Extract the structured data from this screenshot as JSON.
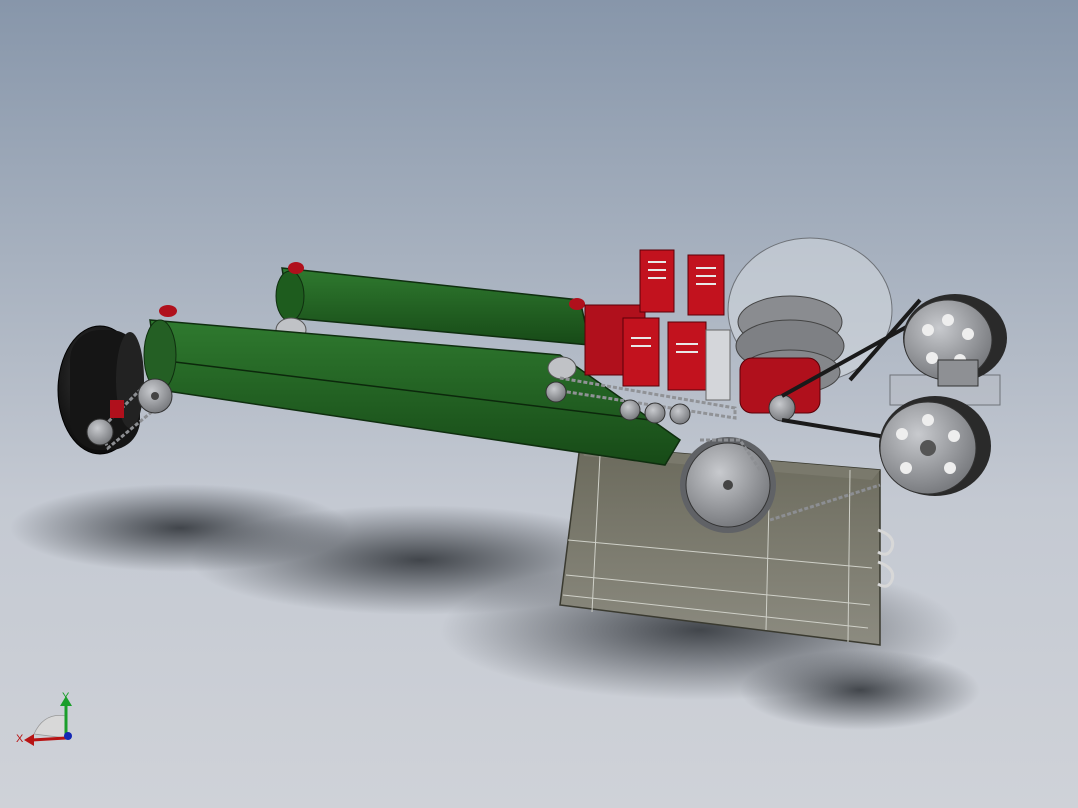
{
  "viewport": {
    "background_top": "#8796aa",
    "background_bottom": "#cfd2d8"
  },
  "model": {
    "belt_color": "#1e5c1e",
    "bracket_color": "#b0101c",
    "drum_color": "#1a1a1a",
    "sprocket_color": "#8c8e92",
    "frame_color": "#5a5a4e"
  },
  "triad": {
    "x_label": "X",
    "y_label": "Y",
    "x_color": "#b81414",
    "y_color": "#1a9e2a",
    "z_color": "#1428b4",
    "icon": "coordinate-triad-icon"
  }
}
